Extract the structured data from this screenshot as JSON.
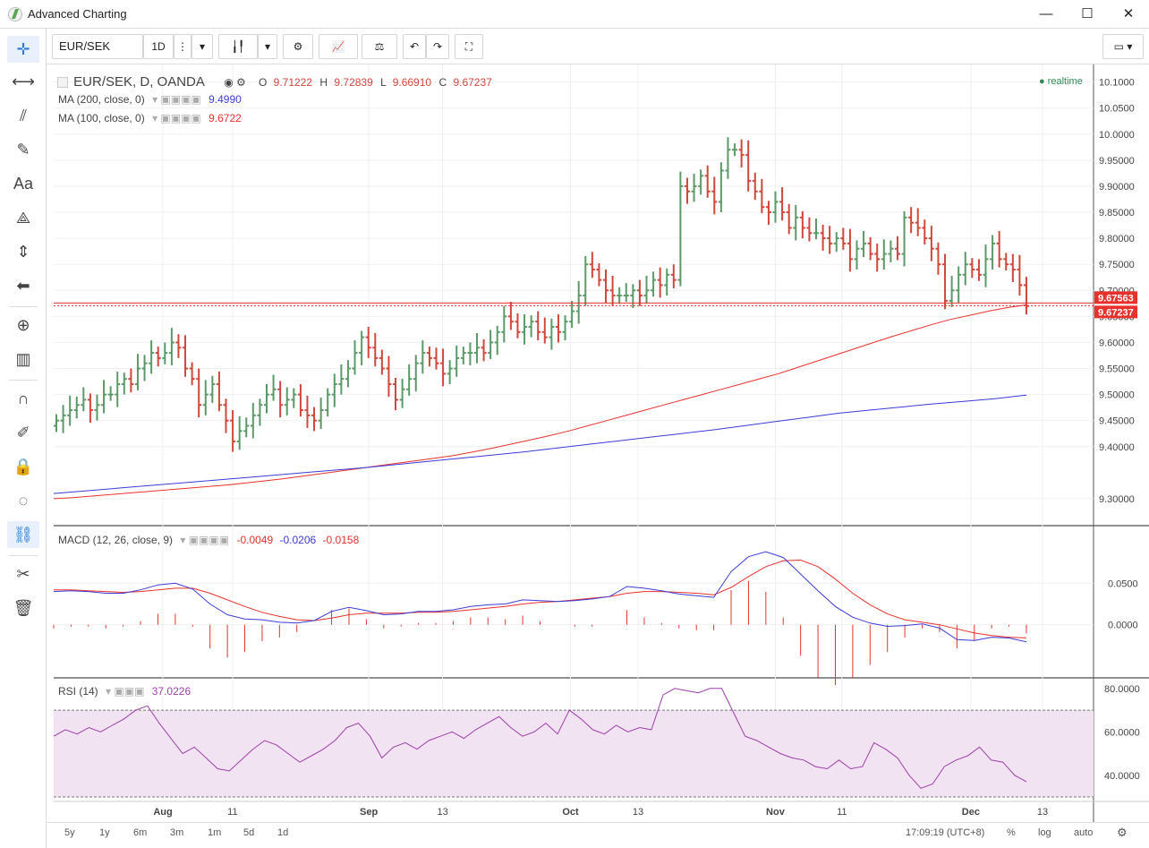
{
  "window": {
    "title": "Advanced Charting",
    "min": "—",
    "max": "☐",
    "close": "✕"
  },
  "toolbar": {
    "symbol": "EUR/SEK",
    "interval": "1D"
  },
  "legend": {
    "main_title": "EUR/SEK, D, OANDA",
    "o_label": "O",
    "o": "9.71222",
    "h_label": "H",
    "h": "9.72839",
    "l_label": "L",
    "l": "9.66910",
    "c_label": "C",
    "c": "9.67237",
    "ma200_label": "MA (200, close, 0)",
    "ma200_value": "9.4990",
    "ma100_label": "MA (100, close, 0)",
    "ma100_value": "9.6722",
    "macd_label": "MACD (12, 26, close, 9)",
    "macd_hist": "-0.0049",
    "macd_macd": "-0.0206",
    "macd_signal": "-0.0158",
    "rsi_label": "RSI (14)",
    "rsi_value": "37.0226",
    "realtime": "realtime"
  },
  "price_tags": {
    "high_tag": "9.67563",
    "last_tag": "9.67237"
  },
  "bottom": {
    "ranges": [
      "5y",
      "1y",
      "6m",
      "3m",
      "1m",
      "5d",
      "1d"
    ],
    "time": "17:09:19 (UTC+8)",
    "percent": "%",
    "log": "log",
    "auto": "auto"
  },
  "colors": {
    "up": "#5b9a68",
    "down": "#d0473c",
    "ma200": "#3b3bd6",
    "ma100": "#e8312c",
    "macd": "#3b3bd6",
    "signal": "#e8312c",
    "hist": "#e8312c",
    "rsi": "#9c3fa8",
    "rsi_band": "#f2e3f2"
  },
  "chart_data": [
    {
      "type": "ohlc",
      "title": "EUR/SEK, D, OANDA",
      "x_labels": [
        "Aug",
        "11",
        "Sep",
        "13",
        "Oct",
        "13",
        "Nov",
        "11",
        "Dec",
        "13"
      ],
      "y_ticks": [
        "10.1000",
        "10.0500",
        "10.0000",
        "9.95000",
        "9.90000",
        "9.85000",
        "9.80000",
        "9.75000",
        "9.70000",
        "9.65000",
        "9.60000",
        "9.55000",
        "9.50000",
        "9.45000",
        "9.40000",
        "9.30000"
      ],
      "ylim": [
        9.25,
        10.12
      ],
      "closes": [
        9.45,
        9.46,
        9.47,
        9.48,
        9.49,
        9.47,
        9.48,
        9.5,
        9.5,
        9.52,
        9.53,
        9.52,
        9.55,
        9.56,
        9.58,
        9.57,
        9.58,
        9.6,
        9.59,
        9.55,
        9.53,
        9.48,
        9.5,
        9.52,
        9.48,
        9.45,
        9.41,
        9.43,
        9.44,
        9.46,
        9.48,
        9.5,
        9.51,
        9.48,
        9.49,
        9.5,
        9.47,
        9.46,
        9.45,
        9.47,
        9.5,
        9.52,
        9.53,
        9.55,
        9.58,
        9.61,
        9.59,
        9.57,
        9.55,
        9.52,
        9.49,
        9.51,
        9.53,
        9.56,
        9.58,
        9.57,
        9.56,
        9.54,
        9.55,
        9.57,
        9.58,
        9.58,
        9.59,
        9.58,
        9.6,
        9.62,
        9.65,
        9.64,
        9.62,
        9.63,
        9.64,
        9.62,
        9.61,
        9.63,
        9.62,
        9.64,
        9.66,
        9.69,
        9.75,
        9.74,
        9.72,
        9.7,
        9.69,
        9.69,
        9.69,
        9.7,
        9.69,
        9.7,
        9.72,
        9.71,
        9.73,
        9.72,
        9.9,
        9.89,
        9.9,
        9.92,
        9.89,
        9.87,
        9.93,
        9.97,
        9.97,
        9.96,
        9.91,
        9.89,
        9.86,
        9.85,
        9.87,
        9.85,
        9.82,
        9.84,
        9.82,
        9.81,
        9.81,
        9.8,
        9.79,
        9.8,
        9.79,
        9.76,
        9.78,
        9.79,
        9.77,
        9.76,
        9.77,
        9.78,
        9.77,
        9.84,
        9.83,
        9.82,
        9.8,
        9.78,
        9.75,
        9.68,
        9.7,
        9.73,
        9.75,
        9.74,
        9.73,
        9.76,
        9.79,
        9.76,
        9.75,
        9.74,
        9.71,
        9.67
      ],
      "ma100": [
        9.3,
        9.302,
        9.305,
        9.308,
        9.311,
        9.314,
        9.317,
        9.32,
        9.323,
        9.326,
        9.33,
        9.334,
        9.338,
        9.343,
        9.348,
        9.353,
        9.358,
        9.363,
        9.368,
        9.373,
        9.378,
        9.383,
        9.39,
        9.397,
        9.405,
        9.413,
        9.421,
        9.43,
        9.44,
        9.45,
        9.46,
        9.47,
        9.48,
        9.49,
        9.5,
        9.51,
        9.52,
        9.53,
        9.54,
        9.552,
        9.564,
        9.576,
        9.588,
        9.6,
        9.612,
        9.623,
        9.634,
        9.644,
        9.652,
        9.66,
        9.667,
        9.6722
      ],
      "ma200": [
        9.31,
        9.315,
        9.32,
        9.325,
        9.33,
        9.335,
        9.34,
        9.345,
        9.35,
        9.355,
        9.36,
        9.366,
        9.372,
        9.378,
        9.384,
        9.39,
        9.397,
        9.404,
        9.411,
        9.418,
        9.425,
        9.432,
        9.44,
        9.448,
        9.456,
        9.464,
        9.47,
        9.476,
        9.482,
        9.487,
        9.492,
        9.499
      ],
      "y_current": 9.67237
    },
    {
      "type": "line",
      "title": "MACD (12, 26, close, 9)",
      "y_ticks": [
        "0.0500",
        "0.0000"
      ],
      "ylim": [
        -0.05,
        0.1
      ],
      "macd": [
        0.04,
        0.041,
        0.04,
        0.038,
        0.038,
        0.042,
        0.048,
        0.05,
        0.043,
        0.025,
        0.012,
        0.007,
        0.006,
        0.003,
        0.002,
        0.005,
        0.016,
        0.021,
        0.017,
        0.012,
        0.013,
        0.016,
        0.016,
        0.018,
        0.022,
        0.024,
        0.025,
        0.03,
        0.029,
        0.028,
        0.029,
        0.031,
        0.034,
        0.046,
        0.044,
        0.041,
        0.037,
        0.035,
        0.033,
        0.064,
        0.082,
        0.088,
        0.081,
        0.061,
        0.041,
        0.022,
        0.009,
        0.002,
        -0.002,
        -0.001,
        0.001,
        -0.004,
        -0.018,
        -0.019,
        -0.015,
        -0.016,
        -0.0206
      ],
      "signal": [
        0.042,
        0.042,
        0.041,
        0.04,
        0.039,
        0.04,
        0.042,
        0.044,
        0.044,
        0.038,
        0.03,
        0.022,
        0.015,
        0.01,
        0.006,
        0.005,
        0.008,
        0.012,
        0.014,
        0.014,
        0.014,
        0.015,
        0.015,
        0.016,
        0.018,
        0.02,
        0.022,
        0.025,
        0.027,
        0.028,
        0.03,
        0.032,
        0.034,
        0.038,
        0.04,
        0.04,
        0.039,
        0.038,
        0.036,
        0.045,
        0.058,
        0.07,
        0.077,
        0.078,
        0.07,
        0.055,
        0.038,
        0.024,
        0.013,
        0.006,
        0.003,
        0.0,
        -0.005,
        -0.01,
        -0.013,
        -0.015,
        -0.0158
      ]
    },
    {
      "type": "line",
      "title": "RSI (14)",
      "y_ticks": [
        "80.0000",
        "60.0000",
        "40.0000"
      ],
      "ylim": [
        30,
        82
      ],
      "overbought": 70,
      "oversold": 30,
      "values": [
        58,
        61,
        59,
        62,
        60,
        63,
        66,
        70,
        72,
        64,
        57,
        50,
        53,
        48,
        43,
        42,
        47,
        52,
        56,
        54,
        50,
        46,
        49,
        52,
        56,
        62,
        64,
        58,
        48,
        53,
        55,
        52,
        56,
        58,
        60,
        57,
        61,
        64,
        67,
        62,
        58,
        60,
        64,
        59,
        70,
        66,
        61,
        59,
        63,
        60,
        62,
        61,
        77,
        80,
        79,
        78,
        80,
        80,
        69,
        58,
        56,
        53,
        50,
        48,
        47,
        44,
        43,
        47,
        43,
        44,
        55,
        52,
        48,
        40,
        34,
        36,
        44,
        47,
        49,
        53,
        47,
        46,
        40,
        37.02
      ]
    }
  ]
}
